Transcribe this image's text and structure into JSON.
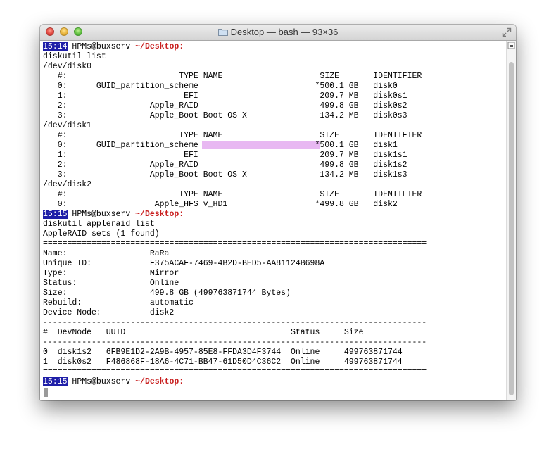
{
  "window": {
    "title": "Desktop — bash — 93×36"
  },
  "prompts": {
    "p1": {
      "time": "15:14",
      "user": "HPMs@buxserv",
      "path": "~/Desktop:"
    },
    "p2": {
      "time": "15:15",
      "user": "HPMs@buxserv",
      "path": "~/Desktop:"
    },
    "p3": {
      "time": "15:15",
      "user": "HPMs@buxserv",
      "path": "~/Desktop:"
    }
  },
  "output": [
    "diskutil list",
    "/dev/disk0",
    "   #:                       TYPE NAME                    SIZE       IDENTIFIER",
    "   0:      GUID_partition_scheme                        *500.1 GB   disk0",
    "   1:                        EFI                         209.7 MB   disk0s1",
    "   2:                 Apple_RAID                         499.8 GB   disk0s2",
    "   3:                 Apple_Boot Boot OS X               134.2 MB   disk0s3",
    "/dev/disk1",
    "   #:                       TYPE NAME                    SIZE       IDENTIFIER",
    "   0:      GUID_partition_scheme                        *500.1 GB   disk1",
    "   1:                        EFI                         209.7 MB   disk1s1",
    "   2:                 Apple_RAID                         499.8 GB   disk1s2",
    "   3:                 Apple_Boot Boot OS X               134.2 MB   disk1s3",
    "/dev/disk2",
    "   #:                       TYPE NAME                    SIZE       IDENTIFIER",
    "   0:                  Apple_HFS v_HD1                  *499.8 GB   disk2",
    "diskutil appleraid list",
    "AppleRAID sets (1 found)",
    "===============================================================================",
    "Name:                 RaRa",
    "Unique ID:            F375ACAF-7469-4B2D-BED5-AA81124B698A",
    "Type:                 Mirror",
    "Status:               Online",
    "Size:                 499.8 GB (499763871744 Bytes)",
    "Rebuild:              automatic",
    "Device Node:          disk2",
    "-------------------------------------------------------------------------------",
    "#  DevNode   UUID                                  Status     Size",
    "-------------------------------------------------------------------------------",
    "0  disk1s2   6FB9E1D2-2A9B-4957-85E8-FFDA3D4F3744  Online     499763871744",
    "1  disk0s2   F486868F-18A6-4C71-BB47-61D50D4C36C2  Online     499763871744",
    "==============================================================================="
  ]
}
